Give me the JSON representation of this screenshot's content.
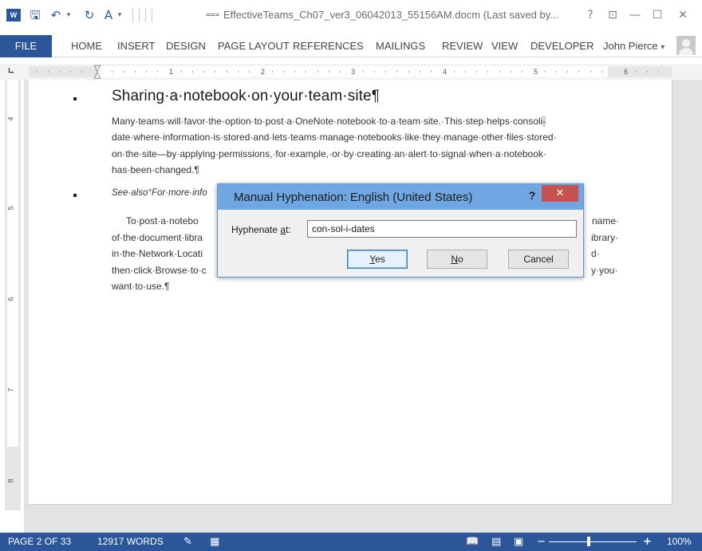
{
  "titlebar": {
    "app_icon": "word-icon",
    "app_logo_text": "W",
    "save_icon": "save-icon",
    "undo_icon": "undo-icon",
    "redo_icon": "redo-icon",
    "format_icon": "format-painter-icon",
    "customize_icon": "customize-qat-icon",
    "title": "EffectiveTeams_Ch07_ver3_06042013_55156AM.docm (Last saved by...",
    "help": "?",
    "restore_icon": "ribbon-display-icon",
    "minimize_icon": "minimize-icon",
    "maximize_icon": "maximize-icon",
    "close_icon": "close-icon"
  },
  "ribbon": {
    "file_label": "FILE",
    "tabs": [
      "HOME",
      "INSERT",
      "DESIGN",
      "PAGE LAYOUT",
      "REFERENCES",
      "MAILINGS",
      "REVIEW",
      "VIEW",
      "DEVELOPER"
    ],
    "user_name": "John Pierce",
    "user_dropdown": "▾"
  },
  "ruler": {
    "numbers": [
      "1",
      "2",
      "3",
      "4",
      "5",
      "6"
    ],
    "vertical_numbers": [
      "4",
      "5",
      "6",
      "7",
      "8"
    ]
  },
  "document": {
    "heading": "Sharing·a·notebook·on·your·team·site¶",
    "para1": [
      "Many·teams·will·favor·the·option·to·post·a·OneNote·notebook·to·a·team·site.·This·step·helps·consoli-",
      "date·where·information·is·stored·and·lets·teams·manage·notebooks·like·they·manage·other·files·stored·",
      "on·the·site—by·applying·permissions,·for·example,·or·by·creating·an·alert·to·signal·when·a·notebook·",
      "has·been·changed.¶"
    ],
    "see_also": "See·also°For·more·info",
    "para2_left": [
      "To·post·a·notebo",
      "of·the·document·libra",
      "in·the·Network·Locati",
      "then·click·Browse·to·c",
      "want·to·use.¶"
    ],
    "para2_right": [
      "name·",
      "ibrary·",
      "d·",
      "y·you·"
    ]
  },
  "dialog": {
    "title": "Manual Hyphenation: English (United States)",
    "help": "?",
    "close": "✕",
    "label_prefix": "Hyphenate ",
    "label_underlined": "a",
    "label_suffix": "t:",
    "value": "con-sol-i-dates",
    "yes_prefix": "",
    "yes_underlined": "Y",
    "yes_suffix": "es",
    "no_prefix": "",
    "no_underlined": "N",
    "no_suffix": "o",
    "cancel": "Cancel"
  },
  "status": {
    "page": "PAGE 2 OF 33",
    "words": "12917 WORDS",
    "proofing_icon": "proofing-icon",
    "macro_icon": "macro-record-icon",
    "read_mode_icon": "read-mode-icon",
    "print_layout_icon": "print-layout-icon",
    "web_layout_icon": "web-layout-icon",
    "zoom_minus": "−",
    "zoom_plus": "+",
    "zoom": "100%",
    "zoom_percent": 100
  },
  "colors": {
    "accent": "#2b579a",
    "dialog_title": "#6fa7e3",
    "close_red": "#c75050"
  }
}
